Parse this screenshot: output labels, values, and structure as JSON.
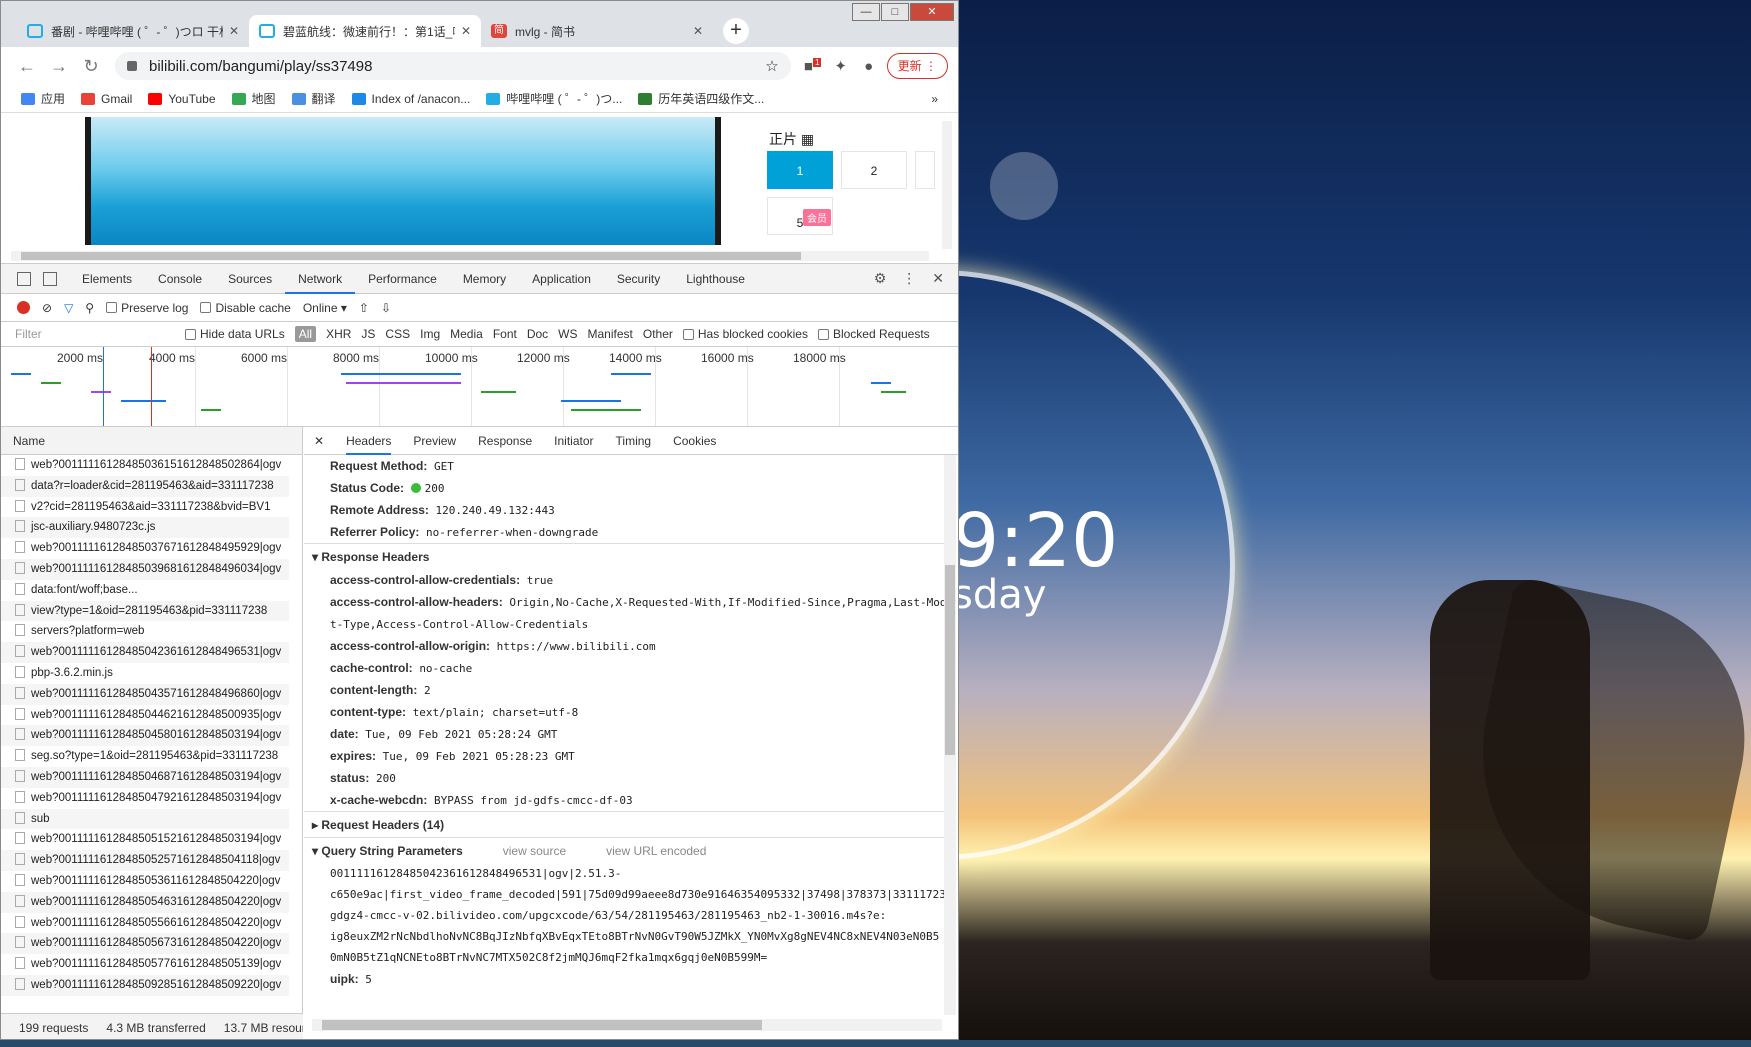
{
  "desktop": {
    "clock": "9:20",
    "day": "sday"
  },
  "browser": {
    "tabs": [
      {
        "title": "番剧 - 哔哩哔哩 ( ゜- ゜)つロ 干杯"
      },
      {
        "title": "碧蓝航线：微速前行！：第1话_哔"
      },
      {
        "title": "mvlg - 简书"
      }
    ],
    "url": "bilibili.com/bangumi/play/ss37498",
    "update_label": "更新",
    "ext_badge": "1",
    "bookmarks": [
      "应用",
      "Gmail",
      "YouTube",
      "地图",
      "翻译",
      "Index of /anacon...",
      "哔哩哔哩 ( ゜- ゜)つ...",
      "历年英语四级作文..."
    ],
    "bookmark_colors": [
      "#4285f4",
      "#ea4335",
      "#ff0000",
      "#34a853",
      "#4a90e2",
      "#1e88e5",
      "#23ade5",
      "#2e7d32"
    ]
  },
  "page": {
    "section_title": "正片",
    "episodes": [
      "1",
      "2",
      "",
      "5"
    ],
    "vip_badge": "会员"
  },
  "devtools": {
    "tabs": [
      "Elements",
      "Console",
      "Sources",
      "Network",
      "Performance",
      "Memory",
      "Application",
      "Security",
      "Lighthouse"
    ],
    "active_tab": "Network",
    "preserve_log": "Preserve log",
    "disable_cache": "Disable cache",
    "throttle": "Online",
    "filter_placeholder": "Filter",
    "hide_data_urls": "Hide data URLs",
    "all": "All",
    "types": [
      "XHR",
      "JS",
      "CSS",
      "Img",
      "Media",
      "Font",
      "Doc",
      "WS",
      "Manifest",
      "Other"
    ],
    "blocked_cookies": "Has blocked cookies",
    "blocked_requests": "Blocked Requests",
    "ticks": [
      "2000 ms",
      "4000 ms",
      "6000 ms",
      "8000 ms",
      "10000 ms",
      "12000 ms",
      "14000 ms",
      "16000 ms",
      "18000 ms"
    ],
    "name_header": "Name",
    "requests": [
      "web?00111116128485036151612848502864|ogv",
      "data?r=loader&cid=281195463&aid=331117238",
      "v2?cid=281195463&aid=331117238&bvid=BV1",
      "jsc-auxiliary.9480723c.js",
      "web?00111116128485037671612848495929|ogv",
      "web?00111116128485039681612848496034|ogv",
      "data:font/woff;base...",
      "view?type=1&oid=281195463&pid=331117238",
      "servers?platform=web",
      "web?00111116128485042361612848496531|ogv",
      "pbp-3.6.2.min.js",
      "web?00111116128485043571612848496860|ogv",
      "web?00111116128485044621612848500935|ogv",
      "web?00111116128485045801612848503194|ogv",
      "seg.so?type=1&oid=281195463&pid=331117238",
      "web?00111116128485046871612848503194|ogv",
      "web?00111116128485047921612848503194|ogv",
      "sub",
      "web?00111116128485051521612848503194|ogv",
      "web?00111116128485052571612848504118|ogv",
      "web?00111116128485053611612848504220|ogv",
      "web?00111116128485054631612848504220|ogv",
      "web?00111116128485055661612848504220|ogv",
      "web?00111116128485056731612848504220|ogv",
      "web?00111116128485057761612848505139|ogv",
      "web?00111116128485092851612848509220|ogv"
    ],
    "status_bar": {
      "requests": "199 requests",
      "transferred": "4.3 MB transferred",
      "resources": "13.7 MB resour"
    },
    "detail_tabs": [
      "Headers",
      "Preview",
      "Response",
      "Initiator",
      "Timing",
      "Cookies"
    ],
    "general": [
      {
        "k": "Request Method:",
        "v": "GET"
      },
      {
        "k": "Status Code:",
        "v": "200"
      },
      {
        "k": "Remote Address:",
        "v": "120.240.49.132:443"
      },
      {
        "k": "Referrer Policy:",
        "v": "no-referrer-when-downgrade"
      }
    ],
    "response_headers_title": "Response Headers",
    "response_headers": [
      {
        "k": "access-control-allow-credentials:",
        "v": "true"
      },
      {
        "k": "access-control-allow-headers:",
        "v": "Origin,No-Cache,X-Requested-With,If-Modified-Since,Pragma,Last-Modi"
      },
      {
        "k": "",
        "v": "t-Type,Access-Control-Allow-Credentials"
      },
      {
        "k": "access-control-allow-origin:",
        "v": "https://www.bilibili.com"
      },
      {
        "k": "cache-control:",
        "v": "no-cache"
      },
      {
        "k": "content-length:",
        "v": "2"
      },
      {
        "k": "content-type:",
        "v": "text/plain; charset=utf-8"
      },
      {
        "k": "date:",
        "v": "Tue, 09 Feb 2021 05:28:24 GMT"
      },
      {
        "k": "expires:",
        "v": "Tue, 09 Feb 2021 05:28:23 GMT"
      },
      {
        "k": "status:",
        "v": "200"
      },
      {
        "k": "x-cache-webcdn:",
        "v": "BYPASS from jd-gdfs-cmcc-df-03"
      }
    ],
    "request_headers_title": "Request Headers (14)",
    "query_title": "Query String Parameters",
    "view_source": "view source",
    "view_url_encoded": "view URL encoded",
    "query_lines": [
      "00111116128485042361612848496531|ogv|2.51.3-",
      "c650e9ac|first_video_frame_decoded|591|75d09d99aeee8d730e91646354095332|37498|378373|331117238",
      "gdgz4-cmcc-v-02.bilivideo.com/upgcxcode/63/54/281195463/281195463_nb2-1-30016.m4s?e:",
      "ig8euxZM2rNcNbdlhoNvNC8BqJIzNbfqXBvEqxTEto8BTrNvN0GvT90W5JZMkX_YN0MvXg8gNEV4NC8xNEV4N03eN0B5",
      "0mN0B5tZ1qNCNEto8BTrNvNC7MTX502C8f2jmMQJ6mqF2fka1mqx6gqj0eN0B599M="
    ],
    "uipk": {
      "k": "uipk:",
      "v": "5"
    }
  }
}
